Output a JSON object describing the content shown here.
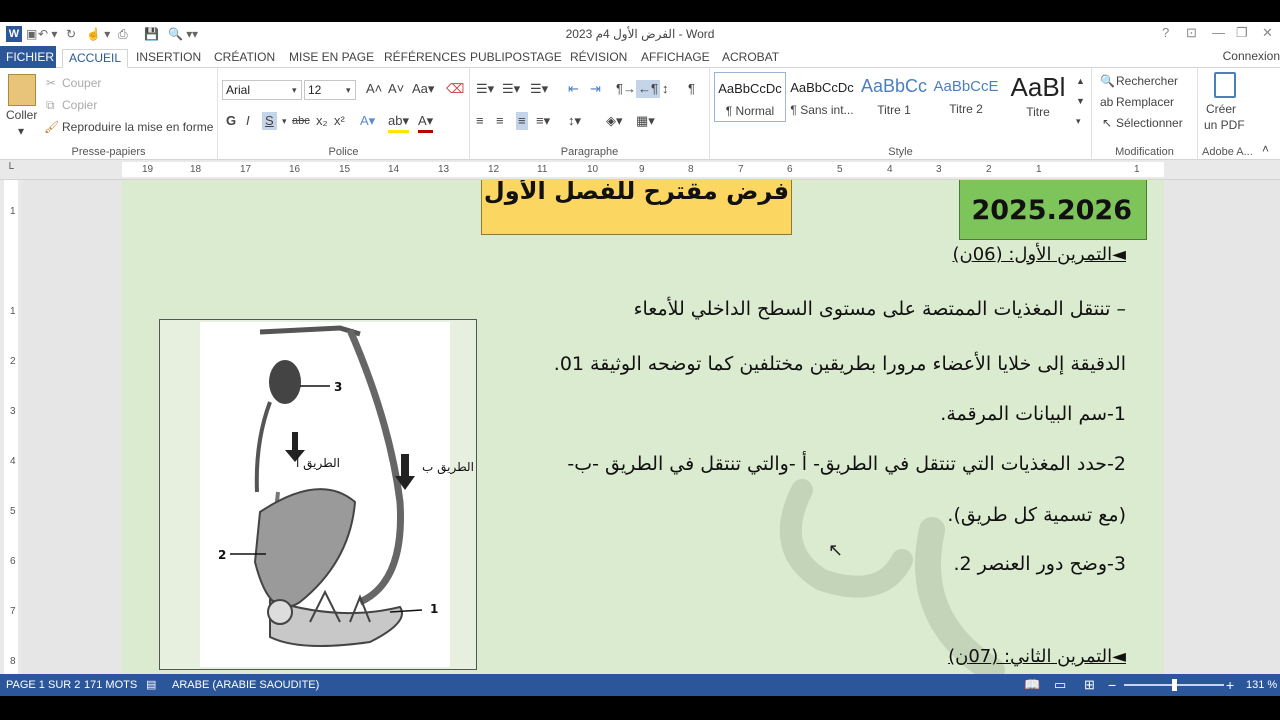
{
  "titlebar": {
    "doc_title": "الفرض الأول 4م 2023 - Word",
    "help": "?",
    "minimize": "—",
    "restore": "❐",
    "close": "✕"
  },
  "tabs": {
    "file": "FICHIER",
    "items": [
      "ACCUEIL",
      "INSERTION",
      "CRÉATION",
      "MISE EN PAGE",
      "RÉFÉRENCES",
      "PUBLIPOSTAGE",
      "RÉVISION",
      "AFFICHAGE",
      "ACROBAT"
    ],
    "connexion": "Connexion"
  },
  "ribbon": {
    "clipboard": {
      "paste": "Coller",
      "cut": "Couper",
      "copy": "Copier",
      "format_painter": "Reproduire la mise en forme",
      "label": "Presse-papiers"
    },
    "font": {
      "name": "Arial",
      "size": "12",
      "label": "Police"
    },
    "paragraph": {
      "label": "Paragraphe"
    },
    "styles": {
      "items": [
        {
          "preview": "AaBbCcDc",
          "name": "¶ Normal"
        },
        {
          "preview": "AaBbCcDc",
          "name": "¶ Sans int..."
        },
        {
          "preview": "AaBbCc",
          "name": "Titre 1"
        },
        {
          "preview": "AaBbCcE",
          "name": "Titre 2"
        },
        {
          "preview": "AaBl",
          "name": "Titre"
        }
      ],
      "label": "Style"
    },
    "editing": {
      "find": "Rechercher",
      "replace": "Remplacer",
      "select": "Sélectionner",
      "label": "Modification"
    },
    "adobe": {
      "create": "Créer",
      "pdf": "un PDF",
      "label": "Adobe A..."
    }
  },
  "ruler_ticks": [
    "19",
    "18",
    "17",
    "16",
    "15",
    "14",
    "13",
    "12",
    "11",
    "10",
    "9",
    "8",
    "7",
    "6",
    "5",
    "4",
    "3",
    "2",
    "1",
    "1"
  ],
  "vruler_ticks": [
    "1",
    "1",
    "2",
    "3",
    "4",
    "5",
    "6",
    "7",
    "8"
  ],
  "document": {
    "header_title": "فرض مقترح للفصل الأول",
    "year": "2025.2026",
    "exercise1": "◄التمرين الأول: (06ن)",
    "lines": [
      "– تنتقل المغذيات الممتصة على مستوى السطح الداخلي للأمعاء",
      "الدقيقة إلى خلايا الأعضاء مرورا بطريقين مختلفين كما توضحه الوثيقة 01.",
      "1-سم البيانات المرقمة.",
      "2-حدد المغذيات التي تنتقل في الطريق- أ -والتي تنتقل في الطريق -ب-",
      "(مع تسمية كل طريق).",
      "3-وضح دور العنصر 2."
    ],
    "exercise2": "◄التمرين الثاني: (07ن)",
    "figure": {
      "label1": "1",
      "label2": "2",
      "label3": "3",
      "path_a": "الطريق أ",
      "path_b": "الطريق ب"
    }
  },
  "status": {
    "page": "PAGE 1 SUR 2",
    "words": "171 MOTS",
    "language": "ARABE (ARABIE SAOUDITE)",
    "zoom": "131 %"
  },
  "colors": {
    "accent": "#2b579a",
    "page_bg": "#dbebcf",
    "yellow_box": "#fbd761",
    "green_box": "#7dc45a"
  }
}
